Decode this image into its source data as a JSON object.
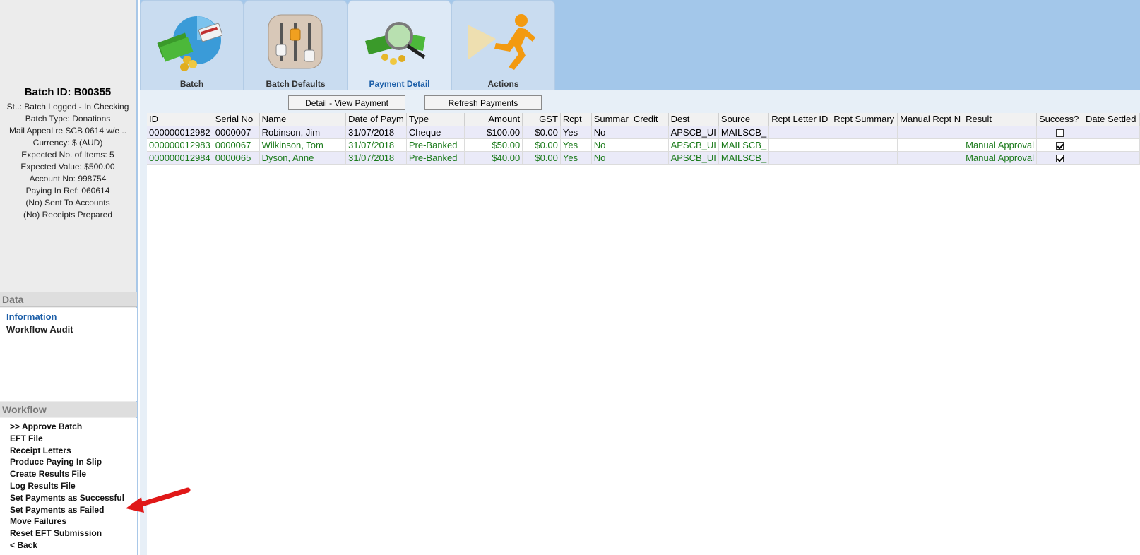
{
  "left_panel": {
    "batch_title": "Batch ID: B00355",
    "info_lines": [
      "St..: Batch Logged - In Checking",
      "Batch Type: Donations",
      "Mail Appeal re SCB 0614 w/e ..",
      "Currency: $ (AUD)",
      "Expected No. of Items: 5",
      "Expected Value: $500.00",
      "Account No: 998754",
      "Paying In Ref: 060614",
      "(No) Sent To Accounts",
      "(No) Receipts Prepared"
    ],
    "data_section": {
      "header": "Data",
      "items": [
        "Information",
        "Workflow Audit"
      ]
    },
    "workflow_section": {
      "header": "Workflow",
      "items": [
        ">> Approve Batch",
        "EFT File",
        "Receipt Letters",
        "Produce Paying In Slip",
        "Create Results File",
        "Log Results File",
        "Set Payments as Successful",
        "Set Payments as Failed",
        "Move Failures",
        "Reset EFT Submission",
        "< Back"
      ]
    }
  },
  "tabs": [
    {
      "label": "Batch",
      "icon": "batch-icon"
    },
    {
      "label": "Batch Defaults",
      "icon": "sliders-icon"
    },
    {
      "label": "Payment Detail",
      "icon": "magnifier-money-icon"
    },
    {
      "label": "Actions",
      "icon": "running-man-icon"
    }
  ],
  "toolbar": {
    "detail_button": "Detail - View Payment",
    "refresh_button": "Refresh Payments"
  },
  "grid": {
    "columns": [
      "ID",
      "Serial No",
      "Name",
      "Date of Paym",
      "Type",
      "Amount",
      "GST",
      "Rcpt",
      "Summar",
      "Credit",
      "Dest",
      "Source",
      "Rcpt Letter ID",
      "Rcpt Summary",
      "Manual Rcpt N",
      "Result",
      "Success?",
      "Date Settled"
    ],
    "rows": [
      {
        "id": "000000012982",
        "serial": "0000007",
        "name": "Robinson, Jim",
        "date": "31/07/2018",
        "type": "Cheque",
        "amount": "$100.00",
        "gst": "$0.00",
        "rcpt": "Yes",
        "summary": "No",
        "credit": "",
        "dest": "APSCB_UI",
        "source": "MAILSCB_",
        "rcpt_letter": "",
        "rcpt_summary": "",
        "manual": "",
        "result": "",
        "success": false,
        "settled": ""
      },
      {
        "id": "000000012983",
        "serial": "0000067",
        "name": "Wilkinson, Tom",
        "date": "31/07/2018",
        "type": "Pre-Banked",
        "amount": "$50.00",
        "gst": "$0.00",
        "rcpt": "Yes",
        "summary": "No",
        "credit": "",
        "dest": "APSCB_UI",
        "source": "MAILSCB_",
        "rcpt_letter": "",
        "rcpt_summary": "",
        "manual": "",
        "result": "Manual Approval",
        "success": true,
        "settled": ""
      },
      {
        "id": "000000012984",
        "serial": "0000065",
        "name": "Dyson, Anne",
        "date": "31/07/2018",
        "type": "Pre-Banked",
        "amount": "$40.00",
        "gst": "$0.00",
        "rcpt": "Yes",
        "summary": "No",
        "credit": "",
        "dest": "APSCB_UI",
        "source": "MAILSCB_",
        "rcpt_letter": "",
        "rcpt_summary": "",
        "manual": "",
        "result": "Manual Approval",
        "success": true,
        "settled": ""
      }
    ]
  },
  "colors": {
    "accent_blue": "#1b5ea8",
    "approved_green": "#1a7a1a",
    "top_bar": "#a3c7ea",
    "annotation_arrow": "#e01818"
  }
}
